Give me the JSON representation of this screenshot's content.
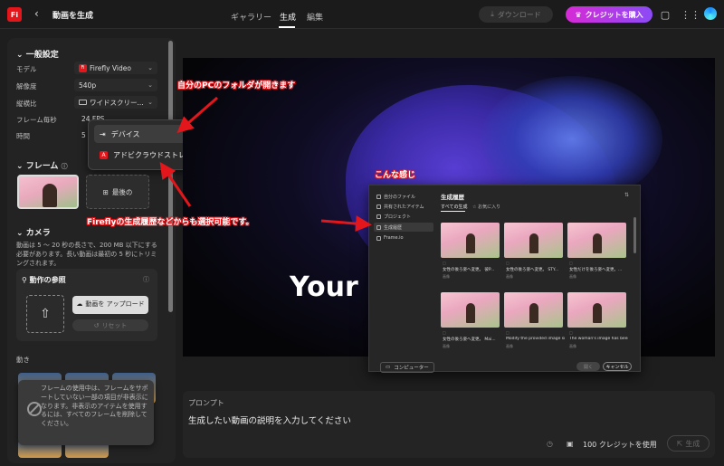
{
  "app": {
    "logo": "Fi",
    "title": "動画を生成"
  },
  "nav": {
    "tabs": [
      "ギャラリー",
      "生成",
      "編集"
    ]
  },
  "header": {
    "download": "ダウンロード",
    "buy": "クレジットを購入"
  },
  "settings": {
    "title": "一般設定",
    "rows": [
      {
        "label": "モデル",
        "value": "Firefly Video"
      },
      {
        "label": "解像度",
        "value": "540p"
      },
      {
        "label": "縦横比",
        "value": "ワイドスクリー..."
      },
      {
        "label": "フレーム毎秒",
        "value": "24 FPS"
      },
      {
        "label": "時間",
        "value": "5"
      }
    ]
  },
  "source_menu": {
    "items": [
      "デバイス",
      "アドビクラウドストレージ"
    ]
  },
  "frame": {
    "title": "フレーム",
    "last": "最後の"
  },
  "camera": {
    "title": "カメラ",
    "note": "動画は 5 〜 20 秒の長さで、200 MB 以下にする必要があります。長い動画は最初の 5 秒にトリミングされます。"
  },
  "motion_ref": {
    "title": "動作の参照",
    "upload": "動画を アップロード",
    "reset": "リセット"
  },
  "motion": {
    "label": "動き"
  },
  "tooltip": "フレームの使用中は、フレームをサポートしていない一部の項目が非表示になります。非表示のアイテムを使用するには、すべてのフレームを削除してください。",
  "preview": {
    "overlay_text": "Your"
  },
  "history_panel": {
    "side": [
      "自分のファイル",
      "共有されたアイテム",
      "プロジェクト",
      "生成履歴",
      "Frame.io"
    ],
    "title": "生成履歴",
    "tabs": [
      "すべての生成",
      "お気に入り"
    ],
    "cards": [
      {
        "caption": "女性の後ろ姿へ変更。 彼P...",
        "kind": "画像"
      },
      {
        "caption": "女性の後ろ姿へ変更。 STY...",
        "kind": "画像"
      },
      {
        "caption": "女性だけを後ろ姿へ変更。...",
        "kind": "画像"
      },
      {
        "caption": "女性の後ろ姿へ変更。 Mai...",
        "kind": "画像"
      },
      {
        "caption": "Modify the provided image si...",
        "kind": "画像"
      },
      {
        "caption": "The woman's image has been...",
        "kind": "画像"
      }
    ],
    "computer": "コンピューター",
    "open": "開く",
    "cancel": "キャンセル"
  },
  "annotations": {
    "folder": "自分のPCのフォルダが開きます",
    "like_this": "こんな感じ",
    "firefly": "Fireflyの生成履歴などからも選択可能です。"
  },
  "prompt": {
    "label": "プロンプト",
    "placeholder": "生成したい動画の説明を入力してください"
  },
  "footer": {
    "credits": "100 クレジットを使用",
    "generate": "生成"
  },
  "colors": {
    "accent": "#e3161b",
    "buy_gradient_start": "#d62ad6",
    "buy_gradient_end": "#8b4bf5"
  }
}
